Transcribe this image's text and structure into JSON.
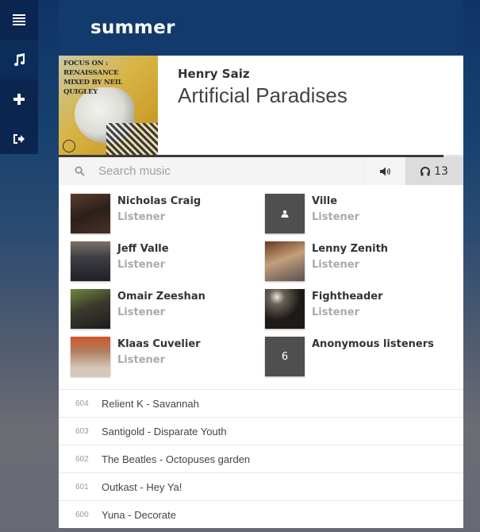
{
  "sidebar": {
    "items": [
      {
        "name": "playlists",
        "icon": "list-icon"
      },
      {
        "name": "music",
        "icon": "music-note-icon"
      },
      {
        "name": "add",
        "icon": "plus-icon"
      },
      {
        "name": "logout",
        "icon": "sign-out-icon"
      }
    ]
  },
  "header": {
    "title": "summer"
  },
  "now_playing": {
    "album_art_text_line1": "FOCUS ON : RENAISSANCE",
    "album_art_text_line2": "MIXED BY NEIL QUIGLEY",
    "artist": "Henry Saiz",
    "title": "Artificial Paradises",
    "progress_fraction": 0.95
  },
  "search": {
    "placeholder": "Search music",
    "value": "",
    "search_icon": "search-icon",
    "volume_icon": "volume-icon",
    "headphones_icon": "headphones-icon",
    "listener_count": "13"
  },
  "listeners": [
    {
      "name": "Nicholas Craig",
      "role": "Listener",
      "avatar": "photo"
    },
    {
      "name": "Ville",
      "role": "Listener",
      "avatar": "user-placeholder"
    },
    {
      "name": "Jeff Valle",
      "role": "Listener",
      "avatar": "photo"
    },
    {
      "name": "Lenny Zenith",
      "role": "Listener",
      "avatar": "photo"
    },
    {
      "name": "Omair Zeeshan",
      "role": "Listener",
      "avatar": "photo"
    },
    {
      "name": "Fightheader",
      "role": "Listener",
      "avatar": "photo"
    },
    {
      "name": "Klaas Cuvelier",
      "role": "Listener",
      "avatar": "photo"
    },
    {
      "name": "Anonymous listeners",
      "role": "",
      "avatar": "count",
      "count": "6"
    }
  ],
  "history": [
    {
      "number": "604",
      "title": "Relient K - Savannah"
    },
    {
      "number": "603",
      "title": "Santigold - Disparate Youth"
    },
    {
      "number": "602",
      "title": "The Beatles - Octopuses garden"
    },
    {
      "number": "601",
      "title": "Outkast - Hey Ya!"
    },
    {
      "number": "600",
      "title": "Yuna - Decorate"
    }
  ]
}
